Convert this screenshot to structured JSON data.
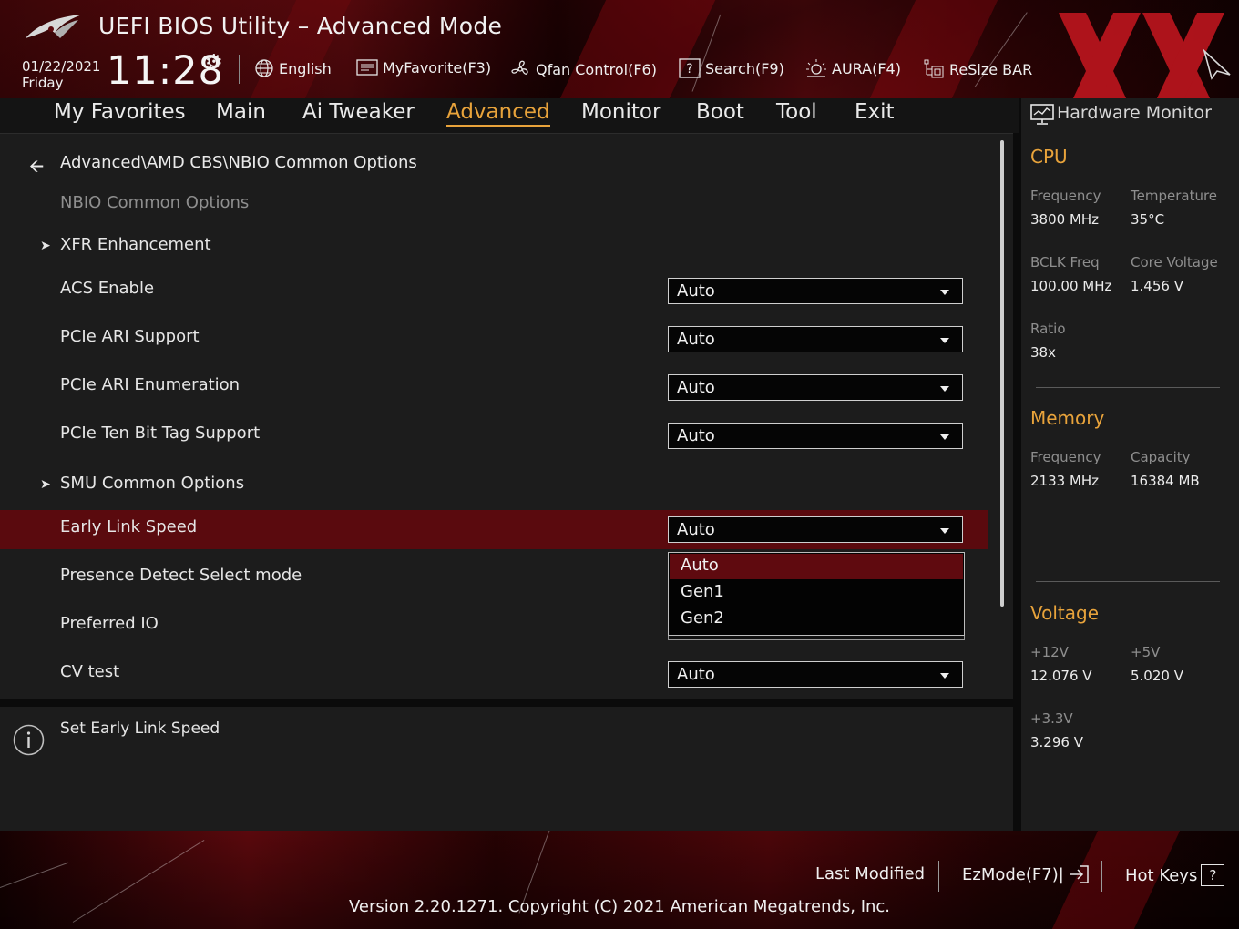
{
  "app_title": "UEFI BIOS Utility – Advanced Mode",
  "date": "01/22/2021",
  "day": "Friday",
  "time": "11:28",
  "toolbar": [
    {
      "icon": "globe-icon",
      "label": "English"
    },
    {
      "icon": "favorite-icon",
      "label": "MyFavorite(F3)"
    },
    {
      "icon": "fan-icon",
      "label": "Qfan Control(F6)"
    },
    {
      "icon": "help-search-icon",
      "label": "Search(F9)"
    },
    {
      "icon": "aura-icon",
      "label": "AURA(F4)"
    },
    {
      "icon": "resize-bar-icon",
      "label": "ReSize BAR"
    }
  ],
  "nav": {
    "tabs": [
      "My Favorites",
      "Main",
      "Ai Tweaker",
      "Advanced",
      "Monitor",
      "Boot",
      "Tool",
      "Exit"
    ],
    "active": "Advanced"
  },
  "main": {
    "breadcrumb": "Advanced\\AMD CBS\\NBIO Common Options",
    "section_title": "NBIO Common Options",
    "items": [
      {
        "label": "XFR Enhancement",
        "type": "submenu"
      },
      {
        "label": "ACS Enable",
        "value": "Auto"
      },
      {
        "label": "PCIe ARI Support",
        "value": "Auto"
      },
      {
        "label": "PCIe ARI Enumeration",
        "value": "Auto"
      },
      {
        "label": "PCIe Ten Bit Tag Support",
        "value": "Auto"
      },
      {
        "label": "SMU Common Options",
        "type": "submenu"
      },
      {
        "label": "Early Link Speed",
        "value": "Auto",
        "selected": true
      },
      {
        "label": "Presence Detect Select mode"
      },
      {
        "label": "Preferred IO"
      },
      {
        "label": "CV test",
        "value": "Auto"
      }
    ],
    "dropdown_options": [
      "Auto",
      "Gen1",
      "Gen2"
    ],
    "dropdown_selected": "Auto"
  },
  "help": {
    "text": "Set Early Link Speed"
  },
  "hw": {
    "title": "Hardware Monitor",
    "cpu": {
      "heading": "CPU",
      "freq_label": "Frequency",
      "freq": "3800 MHz",
      "temp_label": "Temperature",
      "temp": "35°C",
      "bclk_label": "BCLK Freq",
      "bclk": "100.00 MHz",
      "vcore_label": "Core Voltage",
      "vcore": "1.456 V",
      "ratio_label": "Ratio",
      "ratio": "38x"
    },
    "memory": {
      "heading": "Memory",
      "freq_label": "Frequency",
      "freq": "2133 MHz",
      "cap_label": "Capacity",
      "cap": "16384 MB"
    },
    "voltage": {
      "heading": "Voltage",
      "v12_label": "+12V",
      "v12": "12.076 V",
      "v5_label": "+5V",
      "v5": "5.020 V",
      "v33_label": "+3.3V",
      "v33": "3.296 V"
    }
  },
  "footer": {
    "last_modified": "Last Modified",
    "ezmode": "EzMode(F7)|",
    "hotkeys": "Hot Keys",
    "hotkeys_glyph": "?",
    "version": "Version 2.20.1271. Copyright (C) 2021 American Megatrends, Inc."
  },
  "colors": {
    "accent": "#e8a33b",
    "highlight": "#5a0a0e",
    "panel": "#1c1c1c",
    "brand_red": "#b0141c"
  }
}
